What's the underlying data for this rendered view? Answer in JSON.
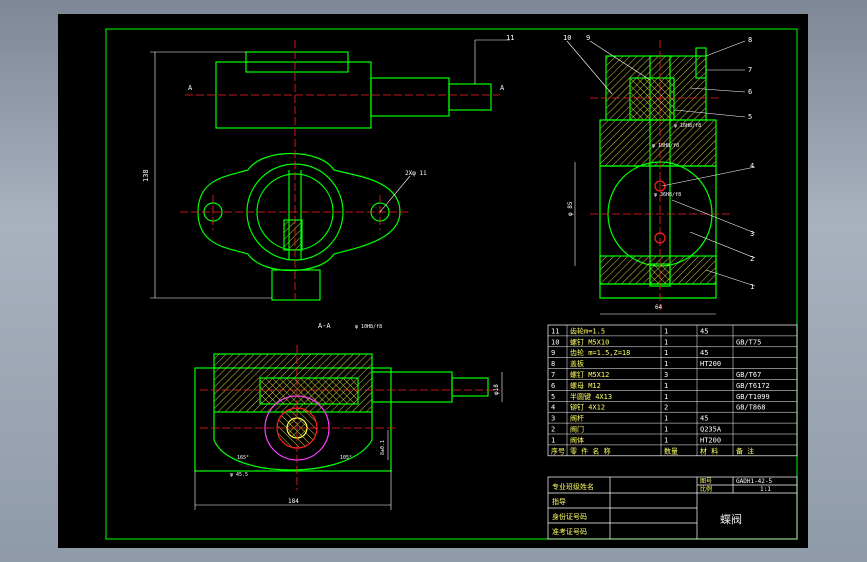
{
  "drawing": {
    "title": "蝶阀",
    "drawing_no": "GADH1-42-5",
    "scale_label": "比例",
    "scale": "1:1",
    "drawing_no_label": "图号",
    "section_label": "A-A",
    "section_letter": "A",
    "dims": {
      "height_138": "138",
      "width_64": "64",
      "dia_85": "φ 85",
      "dia_18": "φ18",
      "dia_18_fit_top": "φ 10H8/f8",
      "dia_16_fit": "φ 16H8/f8",
      "dia_18_fit2": "φ 18H8/f8",
      "dia_36_fit": "φ 36H8/f8",
      "hole": "2Xφ 11",
      "dia_45": "φ 45.5",
      "angle1": "165°",
      "angle2": "105°",
      "dim_8": "8±0.1",
      "width_184": "184"
    },
    "balloons": [
      "11",
      "10",
      "9",
      "8",
      "7",
      "6",
      "5",
      "4",
      "3",
      "2",
      "1"
    ]
  },
  "bom": {
    "header": [
      "序号",
      "零 件 名 称",
      "数量",
      "材 料",
      "备 注"
    ],
    "rows": [
      [
        "11",
        "齿轮m=1.5",
        "1",
        "45",
        ""
      ],
      [
        "10",
        "螺钉 M5X10",
        "1",
        "",
        "GB/T75"
      ],
      [
        "9",
        "齿轮 m=1.5,Z=18",
        "1",
        "45",
        ""
      ],
      [
        "8",
        "盖板",
        "1",
        "HT200",
        ""
      ],
      [
        "7",
        "螺钉 M5X12",
        "3",
        "",
        "GB/T67"
      ],
      [
        "6",
        "螺母 M12",
        "1",
        "",
        "GB/T6172"
      ],
      [
        "5",
        "半圆键 4X13",
        "1",
        "",
        "GB/T1099"
      ],
      [
        "4",
        "铆钉 4X12",
        "2",
        "",
        "GB/T868"
      ],
      [
        "3",
        "阀杆",
        "1",
        "45",
        ""
      ],
      [
        "2",
        "阀门",
        "1",
        "Q235A",
        ""
      ],
      [
        "1",
        "阀体",
        "1",
        "HT200",
        ""
      ]
    ]
  },
  "title_block": {
    "row1": "专业班级姓名",
    "row2": "指导",
    "row3": "身份证号码",
    "row4": "准考证号码"
  },
  "colors": {
    "outline": "#00ff00",
    "center": "#ff2020",
    "hatch": "#ffff40",
    "dim": "#ffffff",
    "magenta": "#ff40ff"
  }
}
